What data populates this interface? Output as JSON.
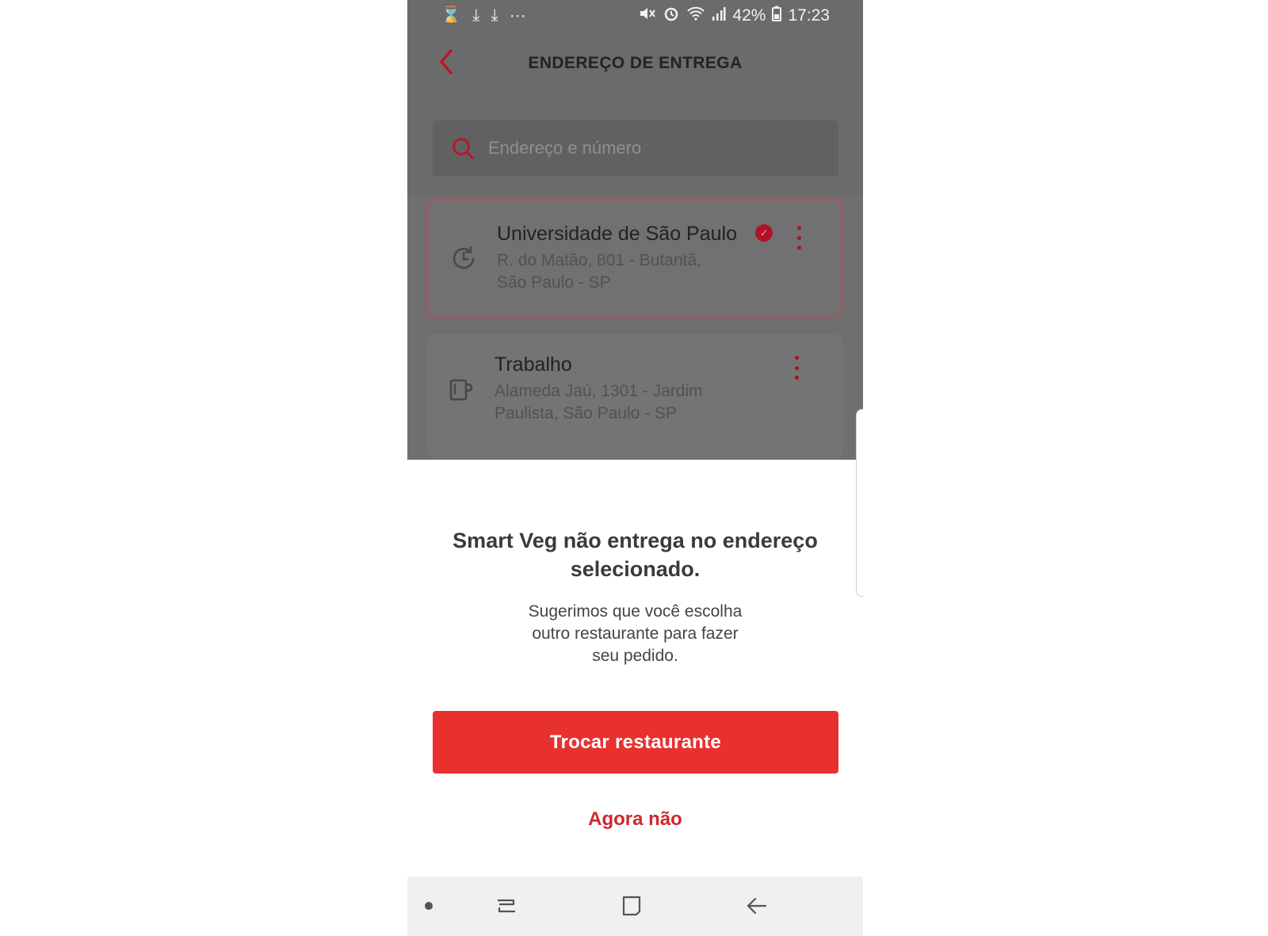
{
  "status_bar": {
    "left_icons": [
      "hourglass-icon",
      "download-icon",
      "download-icon",
      "more-icon"
    ],
    "battery": "42%",
    "time": "17:23"
  },
  "header": {
    "title": "ENDEREÇO DE ENTREGA"
  },
  "search": {
    "placeholder": "Endereço e número"
  },
  "addresses": [
    {
      "title": "Universidade de São Paulo",
      "line1": "R. do Matão, 801 - Butantã,",
      "line2": "São Paulo - SP",
      "icon": "history-icon",
      "selected": true
    },
    {
      "title": "Trabalho",
      "line1": "Alameda Jaú, 1301 - Jardim",
      "line2": "Paulista, São Paulo - SP",
      "icon": "coffee-cup-icon",
      "selected": false
    }
  ],
  "dialog": {
    "title_line1": "Smart Veg não entrega no endereço",
    "title_line2": "selecionado.",
    "body_line1": "Sugerimos que você escolha",
    "body_line2": "outro restaurante para fazer",
    "body_line3": "seu pedido.",
    "primary_label": "Trocar restaurante",
    "secondary_label": "Agora não"
  },
  "colors": {
    "accent": "#e8312f",
    "accent_dark": "#c8102e",
    "overlay": "#6b6b6b"
  }
}
